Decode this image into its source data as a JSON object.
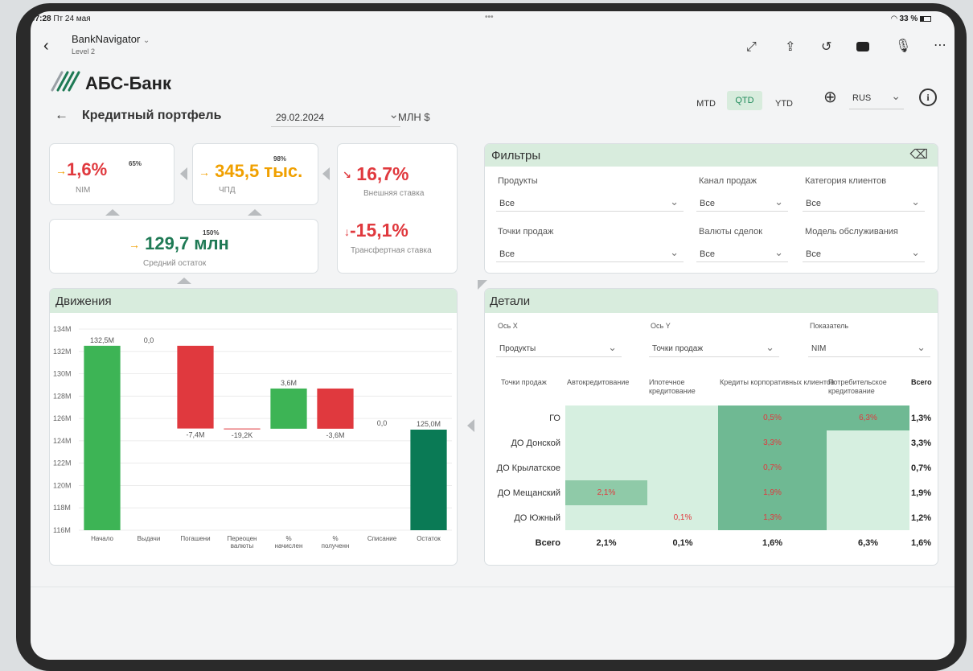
{
  "status_bar": {
    "time": "07:28",
    "date": "Пт 24 мая",
    "dots": "•••",
    "battery": "33 %"
  },
  "app": {
    "title": "BankNavigator",
    "subtitle": "Level 2"
  },
  "brand": {
    "name": "АБС-Банк"
  },
  "page": {
    "title": "Кредитный портфель",
    "date": "29.02.2024",
    "units": "МЛН $",
    "periods": [
      "MTD",
      "QTD",
      "YTD"
    ],
    "lang": "RUS"
  },
  "kpi": {
    "nim": {
      "value": "1,6%",
      "pct": "65%",
      "label": "NIM",
      "arrow": "→"
    },
    "chpd": {
      "value": "345,5 тыс.",
      "pct": "98%",
      "label": "ЧПД",
      "arrow": "→"
    },
    "ext": {
      "value": "16,7%",
      "label": "Внешняя ставка",
      "arrow": "↘"
    },
    "avg": {
      "value": "129,7 млн",
      "pct": "150%",
      "label": "Средний остаток",
      "arrow": "→"
    },
    "transfer": {
      "value": "-15,1%",
      "label": "Трансфертная ставка",
      "arrow": "↓"
    }
  },
  "filters": {
    "title": "Фильтры",
    "fields": [
      {
        "label": "Продукты",
        "value": "Все"
      },
      {
        "label": "Канал продаж",
        "value": "Все"
      },
      {
        "label": "Категория клиентов",
        "value": "Все"
      },
      {
        "label": "Точки продаж",
        "value": "Все"
      },
      {
        "label": "Валюты сделок",
        "value": "Все"
      },
      {
        "label": "Модель обслуживания",
        "value": "Все"
      }
    ]
  },
  "movements": {
    "title": "Движения"
  },
  "chart_data": {
    "type": "bar",
    "subtype": "waterfall",
    "y_tick_labels": [
      "116M",
      "118M",
      "120M",
      "122M",
      "124M",
      "126M",
      "128M",
      "130M",
      "132M",
      "134M"
    ],
    "ylim": [
      116,
      134
    ],
    "categories": [
      "Начало",
      "Выдачи",
      "Погашени",
      "Переоцен валюты",
      "% начислен",
      "% полученн",
      "Списание",
      "Остаток"
    ],
    "category_lines": [
      [
        "Начало"
      ],
      [
        "Выдачи"
      ],
      [
        "Погашени"
      ],
      [
        "Переоцен",
        "валюты"
      ],
      [
        "%",
        "начислен"
      ],
      [
        "%",
        "полученн"
      ],
      [
        "Списание"
      ],
      [
        "Остаток"
      ]
    ],
    "values": [
      132.5,
      0.0,
      -7.4,
      -0.0192,
      3.6,
      -3.6,
      0.0,
      125.0
    ],
    "data_labels": [
      "132,5M",
      "0,0",
      "-7,4M",
      "-19,2K",
      "3,6M",
      "-3,6M",
      "0,0",
      "125,0M"
    ],
    "colors": {
      "start": "#3db455",
      "increase": "#3db455",
      "decrease": "#e0393e",
      "total": "#0a7a55"
    },
    "grid": true
  },
  "details": {
    "title": "Детали",
    "axis_x": {
      "label": "Ось X",
      "value": "Продукты"
    },
    "axis_y": {
      "label": "Ось Y",
      "value": "Точки продаж"
    },
    "metric": {
      "label": "Показатель",
      "value": "NIM"
    },
    "table": {
      "corner": "Точки продаж",
      "columns": [
        "Автокредитование",
        "Ипотечное кредитование",
        "Кредиты корпоративных клиентов",
        "Потребительское кредитование",
        "Всего"
      ],
      "rows": [
        {
          "name": "ГО",
          "cells": [
            "",
            "",
            "0,5%",
            "6,3%"
          ],
          "total": "1,3%"
        },
        {
          "name": "ДО Донской",
          "cells": [
            "",
            "",
            "3,3%",
            ""
          ],
          "total": "3,3%"
        },
        {
          "name": "ДО Крылатское",
          "cells": [
            "",
            "",
            "0,7%",
            ""
          ],
          "total": "0,7%"
        },
        {
          "name": "ДО Мещанский",
          "cells": [
            "2,1%",
            "",
            "1,9%",
            ""
          ],
          "total": "1,9%"
        },
        {
          "name": "ДО Южный",
          "cells": [
            "",
            "0,1%",
            "1,3%",
            ""
          ],
          "total": "1,2%"
        }
      ],
      "total_row": {
        "name": "Всего",
        "cells": [
          "2,1%",
          "0,1%",
          "1,6%",
          "6,3%"
        ],
        "total": "1,6%"
      }
    }
  }
}
